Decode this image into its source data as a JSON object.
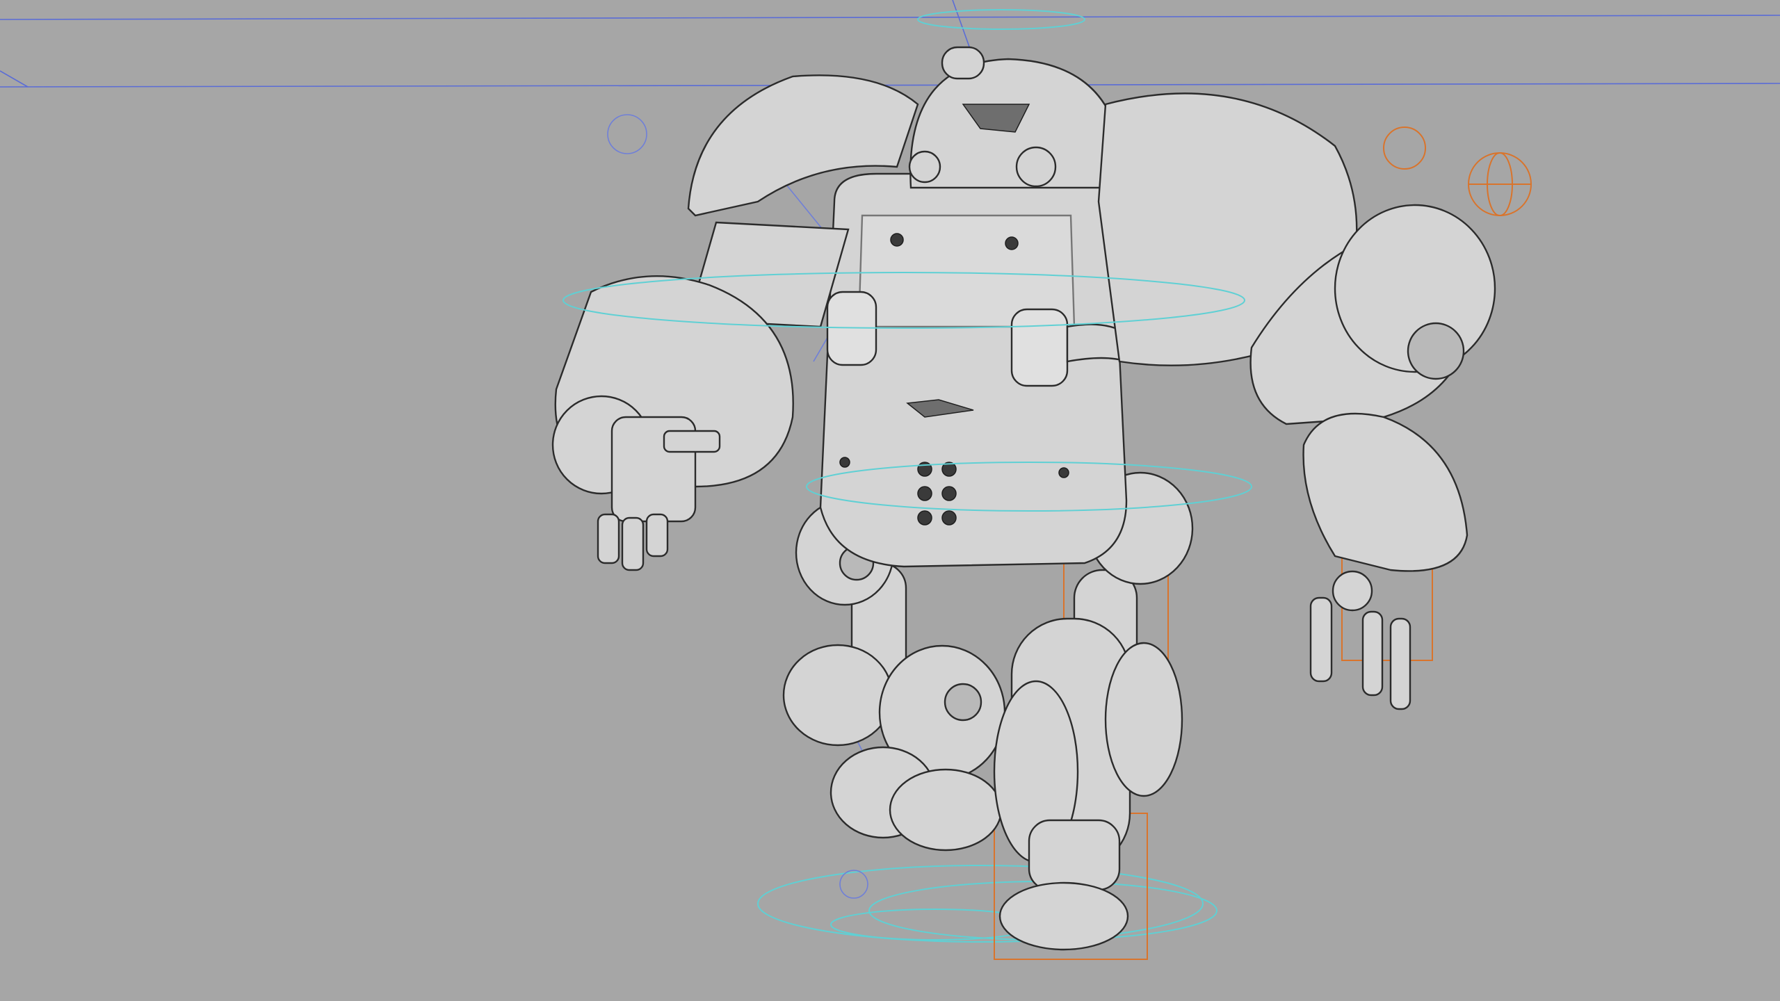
{
  "viewport": {
    "background": "#a6a6a6",
    "mesh_fill": "#d4d4d4",
    "wire_color": "#2b2b2b",
    "control_colors": {
      "cyan": "#5fd0d4",
      "orange": "#d9742c",
      "blue": "#6f7fd8"
    }
  },
  "scene": {
    "subject": "robot-wireframe-model",
    "icons": [
      "axis-gizmo-icon",
      "locator-sphere-icon"
    ]
  }
}
